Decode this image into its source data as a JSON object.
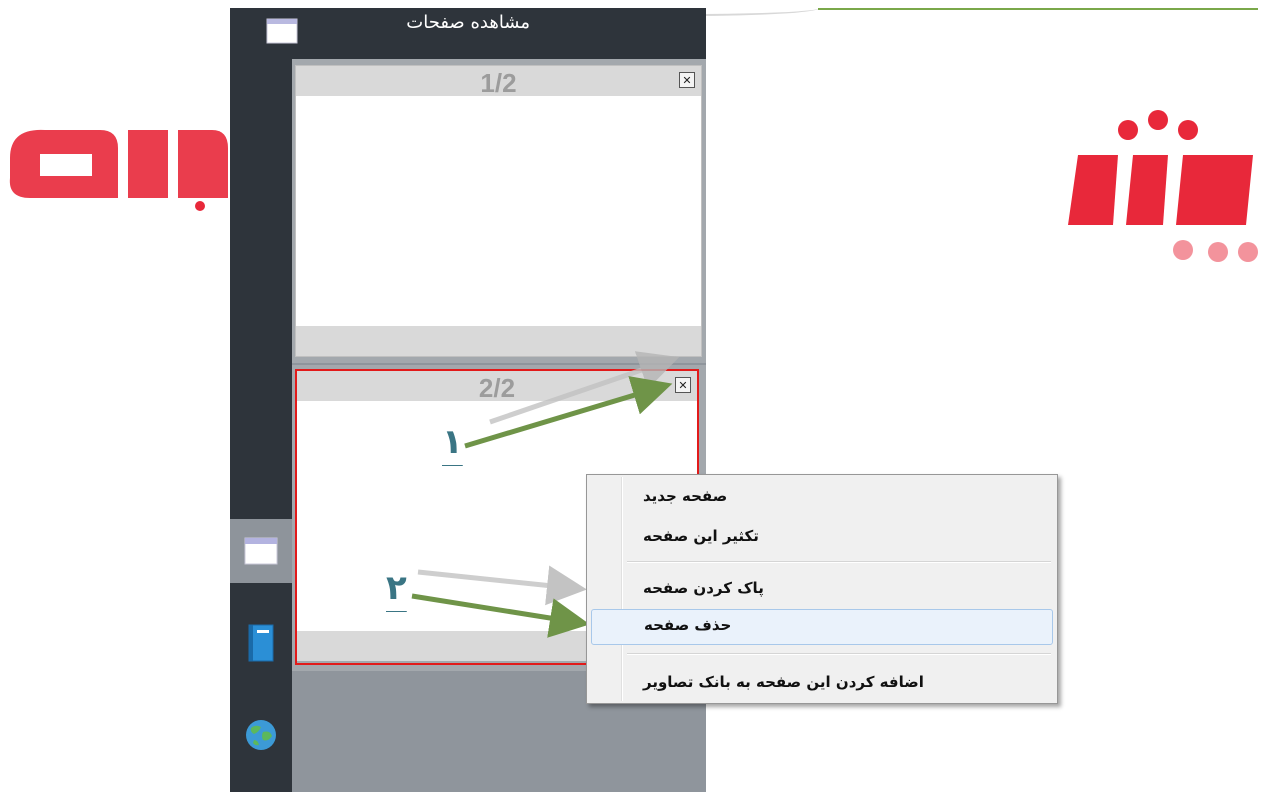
{
  "colors": {
    "accent_red": "#e21a1a",
    "arrow_green": "#6f9448",
    "header_bg": "#2e343b",
    "panel_bg": "#8f959c",
    "digit_teal": "#3a7584",
    "watermark": "#e8283a"
  },
  "header": {
    "title": "مشاهده صفحات",
    "icon": "page-view-icon"
  },
  "rail": [
    {
      "name": "pages",
      "icon": "window-icon",
      "active": true
    },
    {
      "name": "notebook",
      "icon": "book-icon",
      "active": false
    },
    {
      "name": "web",
      "icon": "globe-icon",
      "active": false
    }
  ],
  "pages": [
    {
      "number_label": "1/2",
      "close_icon": "close-icon",
      "selected": false
    },
    {
      "number_label": "2/2",
      "close_icon": "close-icon",
      "selected": true
    }
  ],
  "annotations": {
    "step1": "۱",
    "step2": "۲"
  },
  "context_menu": {
    "items": [
      {
        "label": "صفحه جدید",
        "hover": false
      },
      {
        "label": "تکثیر این صفحه",
        "hover": false
      },
      {
        "label": "پاک کردن صفحه",
        "hover": false
      },
      {
        "label": "حذف صفحه",
        "hover": true
      },
      {
        "label": "اضافه کردن این صفحه به بانک تصاویر",
        "hover": false
      }
    ]
  }
}
